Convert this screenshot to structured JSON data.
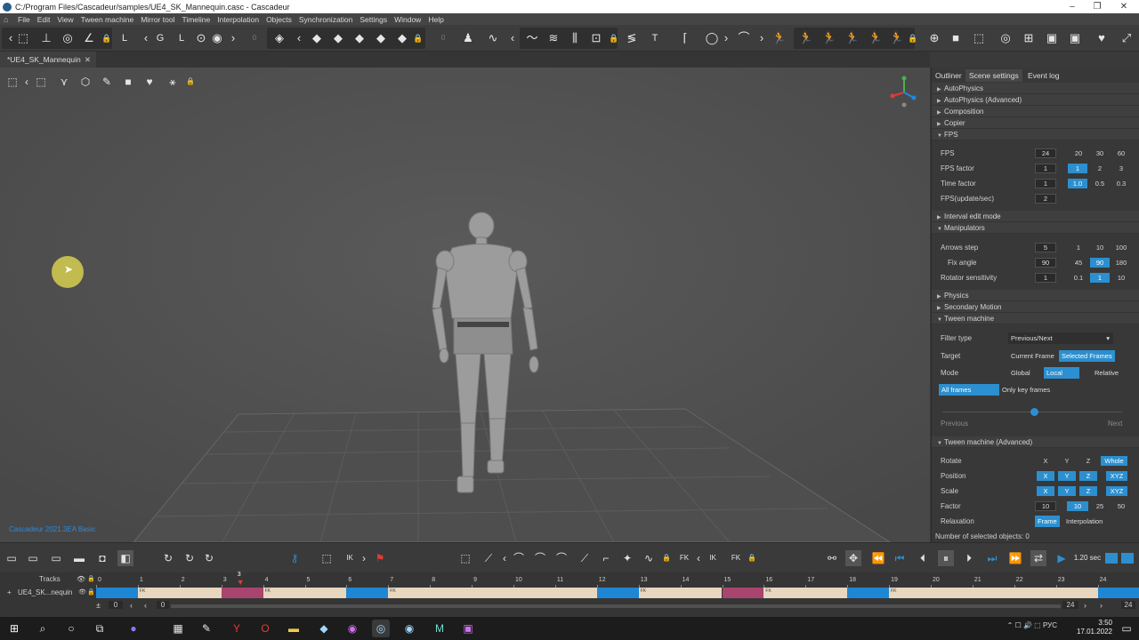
{
  "window": {
    "title": "C:/Program Files/Cascadeur/samples/UE4_SK_Mannequin.casc - Cascadeur",
    "controls": [
      "–",
      "❐",
      "✕"
    ]
  },
  "menu": [
    "File",
    "Edit",
    "View",
    "Tween machine",
    "Mirror tool",
    "Timeline",
    "Interpolation",
    "Objects",
    "Synchronization",
    "Settings",
    "Window",
    "Help"
  ],
  "toolbar": {
    "counters": [
      "0",
      "0"
    ],
    "letters": {
      "L": "L",
      "G": "G",
      "L2": "L",
      "T": "T"
    }
  },
  "document_tab": {
    "label": "*UE4_SK_Mannequin",
    "close": "✕"
  },
  "viewport": {
    "watermark": "Cascadeur 2021.3EA Basic"
  },
  "right_panel": {
    "tabs": [
      "Outliner",
      "Scene settings",
      "Event log"
    ],
    "active_tab": "Scene settings",
    "sections_collapsed_top": [
      "AutoPhysics",
      "AutoPhysics (Advanced)",
      "Composition",
      "Copier"
    ],
    "fps": {
      "header": "FPS",
      "rows": [
        {
          "label": "FPS",
          "value": "24",
          "options": [
            "20",
            "30",
            "60"
          ],
          "selected": -1
        },
        {
          "label": "FPS factor",
          "value": "1",
          "options": [
            "1",
            "2",
            "3"
          ],
          "selected": 0
        },
        {
          "label": "Time factor",
          "value": "1",
          "options": [
            "1.0",
            "0.5",
            "0.3"
          ],
          "selected": 0
        },
        {
          "label": "FPS(update/sec)",
          "value": "2",
          "options": [],
          "selected": -1
        }
      ]
    },
    "interval_edit": "Interval edit mode",
    "manipulators": {
      "header": "Manipulators",
      "rows": [
        {
          "label": "Arrows step",
          "value": "5",
          "options": [
            "1",
            "10",
            "100"
          ],
          "selected": -1
        },
        {
          "label": "Fix angle",
          "value": "90",
          "options": [
            "45",
            "90",
            "180"
          ],
          "selected": 1
        },
        {
          "label": "Rotator sensitivity",
          "value": "1",
          "options": [
            "0.1",
            "1",
            "10"
          ],
          "selected": 1
        }
      ]
    },
    "physics": "Physics",
    "secondary_motion": "Secondary Motion",
    "tween": {
      "header": "Tween machine",
      "filter_type_label": "Filter type",
      "filter_type_value": "Previous/Next",
      "target_label": "Target",
      "target_options": [
        "Current Frame",
        "Selected Frames"
      ],
      "mode_label": "Mode",
      "mode_options": [
        "Global",
        "Local",
        "Relative"
      ],
      "frames_options": [
        "All frames",
        "Only key frames"
      ],
      "slider_left": "Previous",
      "slider_right": "Next",
      "slider_value": 0.42
    },
    "tween_adv": {
      "header": "Tween machine (Advanced)",
      "rotate_label": "Rotate",
      "rotate_options": [
        "X",
        "Y",
        "Z",
        "Whole"
      ],
      "position_label": "Position",
      "position_options": [
        "X",
        "Y",
        "Z",
        "XYZ"
      ],
      "scale_label": "Scale",
      "scale_options": [
        "X",
        "Y",
        "Z",
        "XYZ"
      ],
      "factor_label": "Factor",
      "factor_value": "10",
      "factor_options": [
        "10",
        "25",
        "50"
      ],
      "relaxation_label": "Relaxation",
      "relaxation_options": [
        "Frame",
        "Interpolation"
      ]
    },
    "status": "Number of selected objects: 0"
  },
  "bottom_tools": {
    "speed": "1.20 sec",
    "ik": "IK",
    "fk": "FK"
  },
  "timeline": {
    "tracks_label": "Tracks",
    "track_name": "UE4_SK...nequin",
    "current_frame": "3",
    "ticks": [
      "0",
      "1",
      "2",
      "3",
      "4",
      "5",
      "6",
      "7",
      "8",
      "9",
      "10",
      "11",
      "12",
      "13",
      "14",
      "15",
      "16",
      "17",
      "18",
      "19",
      "20",
      "21",
      "22",
      "23",
      "24"
    ],
    "range_start": "0",
    "range_start2": "0",
    "range_end": "24",
    "range_end2": "24"
  },
  "taskbar": {
    "time": "3:50",
    "date": "17.01.2022",
    "lang": "РУС"
  }
}
